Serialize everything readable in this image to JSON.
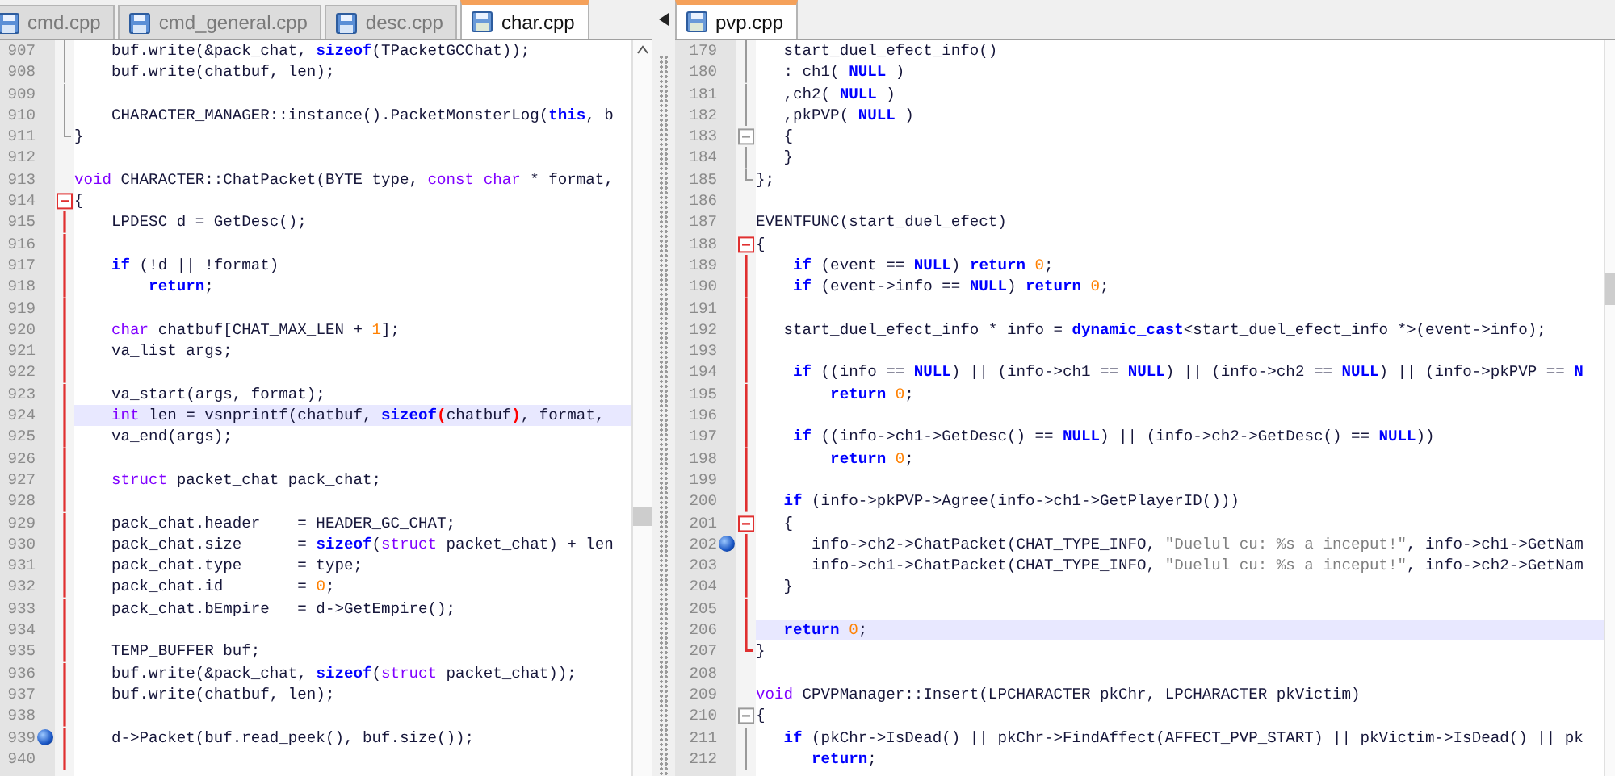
{
  "panes": [
    {
      "tabs": [
        {
          "label": "cmd.cpp",
          "selected": false
        },
        {
          "label": "cmd_general.cpp",
          "selected": false
        },
        {
          "label": "desc.cpp",
          "selected": false
        },
        {
          "label": "char.cpp",
          "selected": true
        }
      ],
      "lines": [
        {
          "number": "907",
          "current": false,
          "bookmarked": false,
          "fold": {
            "kind": "body",
            "active": false
          },
          "tokens": [
            {
              "text": "    buf.write(&pack_chat, ",
              "kind": "plain"
            },
            {
              "text": "sizeof",
              "kind": "keyword"
            },
            {
              "text": "(TPacketGCChat));",
              "kind": "plain"
            }
          ]
        },
        {
          "number": "908",
          "current": false,
          "bookmarked": false,
          "fold": {
            "kind": "body",
            "active": false
          },
          "tokens": [
            {
              "text": "    buf.write(chatbuf, len);",
              "kind": "plain"
            }
          ]
        },
        {
          "number": "909",
          "current": false,
          "bookmarked": false,
          "fold": {
            "kind": "body",
            "active": false
          }
        },
        {
          "number": "910",
          "current": false,
          "bookmarked": false,
          "fold": {
            "kind": "body",
            "active": false
          },
          "tokens": [
            {
              "text": "    CHARACTER_MANAGER::instance().PacketMonsterLog(",
              "kind": "plain"
            },
            {
              "text": "this",
              "kind": "keyword"
            },
            {
              "text": ", b",
              "kind": "plain"
            }
          ]
        },
        {
          "number": "911",
          "current": false,
          "bookmarked": false,
          "fold": {
            "kind": "end",
            "active": false
          },
          "tokens": [
            {
              "text": "}",
              "kind": "plain"
            }
          ]
        },
        {
          "number": "912",
          "current": false,
          "bookmarked": false
        },
        {
          "number": "913",
          "current": false,
          "bookmarked": false,
          "tokens": [
            {
              "text": "void",
              "kind": "type"
            },
            {
              "text": " CHARACTER::ChatPacket(BYTE type, ",
              "kind": "plain"
            },
            {
              "text": "const char",
              "kind": "type"
            },
            {
              "text": " * format,",
              "kind": "plain"
            }
          ]
        },
        {
          "number": "914",
          "current": false,
          "bookmarked": false,
          "fold": {
            "kind": "open",
            "active": true
          },
          "tokens": [
            {
              "text": "{",
              "kind": "plain"
            }
          ]
        },
        {
          "number": "915",
          "current": false,
          "bookmarked": false,
          "fold": {
            "kind": "body",
            "active": true
          },
          "tokens": [
            {
              "text": "    LPDESC d = GetDesc();",
              "kind": "plain"
            }
          ]
        },
        {
          "number": "916",
          "current": false,
          "bookmarked": false,
          "fold": {
            "kind": "body",
            "active": true
          }
        },
        {
          "number": "917",
          "current": false,
          "bookmarked": false,
          "fold": {
            "kind": "body",
            "active": true
          },
          "tokens": [
            {
              "text": "    if",
              "kind": "keyword"
            },
            {
              "text": " (!d || !format)",
              "kind": "plain"
            }
          ]
        },
        {
          "number": "918",
          "current": false,
          "bookmarked": false,
          "fold": {
            "kind": "body",
            "active": true
          },
          "tokens": [
            {
              "text": "        return",
              "kind": "keyword"
            },
            {
              "text": ";",
              "kind": "plain"
            }
          ]
        },
        {
          "number": "919",
          "current": false,
          "bookmarked": false,
          "fold": {
            "kind": "body",
            "active": true
          }
        },
        {
          "number": "920",
          "current": false,
          "bookmarked": false,
          "fold": {
            "kind": "body",
            "active": true
          },
          "tokens": [
            {
              "text": "    char",
              "kind": "type"
            },
            {
              "text": " chatbuf[CHAT_MAX_LEN + ",
              "kind": "plain"
            },
            {
              "text": "1",
              "kind": "number"
            },
            {
              "text": "];",
              "kind": "plain"
            }
          ]
        },
        {
          "number": "921",
          "current": false,
          "bookmarked": false,
          "fold": {
            "kind": "body",
            "active": true
          },
          "tokens": [
            {
              "text": "    va_list args;",
              "kind": "plain"
            }
          ]
        },
        {
          "number": "922",
          "current": false,
          "bookmarked": false,
          "fold": {
            "kind": "body",
            "active": true
          }
        },
        {
          "number": "923",
          "current": false,
          "bookmarked": false,
          "fold": {
            "kind": "body",
            "active": true
          },
          "tokens": [
            {
              "text": "    va_start(args, format);",
              "kind": "plain"
            }
          ]
        },
        {
          "number": "924",
          "current": true,
          "bookmarked": false,
          "fold": {
            "kind": "body",
            "active": true
          },
          "tokens": [
            {
              "text": "    int",
              "kind": "type"
            },
            {
              "text": " len = vsnprintf(chatbuf, ",
              "kind": "plain"
            },
            {
              "text": "sizeof",
              "kind": "keyword"
            },
            {
              "text": "(",
              "kind": "match"
            },
            {
              "text": "chatbuf",
              "kind": "plain"
            },
            {
              "text": ")",
              "kind": "match"
            },
            {
              "text": ", format,",
              "kind": "plain"
            }
          ]
        },
        {
          "number": "925",
          "current": false,
          "bookmarked": false,
          "fold": {
            "kind": "body",
            "active": true
          },
          "tokens": [
            {
              "text": "    va_end(args);",
              "kind": "plain"
            }
          ]
        },
        {
          "number": "926",
          "current": false,
          "bookmarked": false,
          "fold": {
            "kind": "body",
            "active": true
          }
        },
        {
          "number": "927",
          "current": false,
          "bookmarked": false,
          "fold": {
            "kind": "body",
            "active": true
          },
          "tokens": [
            {
              "text": "    struct",
              "kind": "type"
            },
            {
              "text": " packet_chat pack_chat;",
              "kind": "plain"
            }
          ]
        },
        {
          "number": "928",
          "current": false,
          "bookmarked": false,
          "fold": {
            "kind": "body",
            "active": true
          }
        },
        {
          "number": "929",
          "current": false,
          "bookmarked": false,
          "fold": {
            "kind": "body",
            "active": true
          },
          "tokens": [
            {
              "text": "    pack_chat.header    = HEADER_GC_CHAT;",
              "kind": "plain"
            }
          ]
        },
        {
          "number": "930",
          "current": false,
          "bookmarked": false,
          "fold": {
            "kind": "body",
            "active": true
          },
          "tokens": [
            {
              "text": "    pack_chat.size      = ",
              "kind": "plain"
            },
            {
              "text": "sizeof",
              "kind": "keyword"
            },
            {
              "text": "(",
              "kind": "plain"
            },
            {
              "text": "struct",
              "kind": "type"
            },
            {
              "text": " packet_chat) + len",
              "kind": "plain"
            }
          ]
        },
        {
          "number": "931",
          "current": false,
          "bookmarked": false,
          "fold": {
            "kind": "body",
            "active": true
          },
          "tokens": [
            {
              "text": "    pack_chat.type      = type;",
              "kind": "plain"
            }
          ]
        },
        {
          "number": "932",
          "current": false,
          "bookmarked": false,
          "fold": {
            "kind": "body",
            "active": true
          },
          "tokens": [
            {
              "text": "    pack_chat.id        = ",
              "kind": "plain"
            },
            {
              "text": "0",
              "kind": "number"
            },
            {
              "text": ";",
              "kind": "plain"
            }
          ]
        },
        {
          "number": "933",
          "current": false,
          "bookmarked": false,
          "fold": {
            "kind": "body",
            "active": true
          },
          "tokens": [
            {
              "text": "    pack_chat.bEmpire   = d->GetEmpire();",
              "kind": "plain"
            }
          ]
        },
        {
          "number": "934",
          "current": false,
          "bookmarked": false,
          "fold": {
            "kind": "body",
            "active": true
          }
        },
        {
          "number": "935",
          "current": false,
          "bookmarked": false,
          "fold": {
            "kind": "body",
            "active": true
          },
          "tokens": [
            {
              "text": "    TEMP_BUFFER buf;",
              "kind": "plain"
            }
          ]
        },
        {
          "number": "936",
          "current": false,
          "bookmarked": false,
          "fold": {
            "kind": "body",
            "active": true
          },
          "tokens": [
            {
              "text": "    buf.write(&pack_chat, ",
              "kind": "plain"
            },
            {
              "text": "sizeof",
              "kind": "keyword"
            },
            {
              "text": "(",
              "kind": "plain"
            },
            {
              "text": "struct",
              "kind": "type"
            },
            {
              "text": " packet_chat));",
              "kind": "plain"
            }
          ]
        },
        {
          "number": "937",
          "current": false,
          "bookmarked": false,
          "fold": {
            "kind": "body",
            "active": true
          },
          "tokens": [
            {
              "text": "    buf.write(chatbuf, len);",
              "kind": "plain"
            }
          ]
        },
        {
          "number": "938",
          "current": false,
          "bookmarked": false,
          "fold": {
            "kind": "body",
            "active": true
          }
        },
        {
          "number": "939",
          "current": false,
          "bookmarked": true,
          "fold": {
            "kind": "body",
            "active": true
          },
          "tokens": [
            {
              "text": "    d->Packet(buf.read_peek(), buf.size());",
              "kind": "plain"
            }
          ]
        },
        {
          "number": "940",
          "current": false,
          "bookmarked": false,
          "fold": {
            "kind": "body",
            "active": true
          }
        }
      ]
    },
    {
      "tabs": [
        {
          "label": "pvp.cpp",
          "selected": true
        }
      ],
      "lines": [
        {
          "number": "179",
          "current": false,
          "bookmarked": false,
          "fold": {
            "kind": "body",
            "active": false
          },
          "tokens": [
            {
              "text": "   start_duel_efect_info()",
              "kind": "plain"
            }
          ]
        },
        {
          "number": "180",
          "current": false,
          "bookmarked": false,
          "fold": {
            "kind": "body",
            "active": false
          },
          "tokens": [
            {
              "text": "   : ch1( ",
              "kind": "plain"
            },
            {
              "text": "NULL",
              "kind": "keyword"
            },
            {
              "text": " )",
              "kind": "plain"
            }
          ]
        },
        {
          "number": "181",
          "current": false,
          "bookmarked": false,
          "fold": {
            "kind": "body",
            "active": false
          },
          "tokens": [
            {
              "text": "   ,ch2( ",
              "kind": "plain"
            },
            {
              "text": "NULL",
              "kind": "keyword"
            },
            {
              "text": " )",
              "kind": "plain"
            }
          ]
        },
        {
          "number": "182",
          "current": false,
          "bookmarked": false,
          "fold": {
            "kind": "body",
            "active": false
          },
          "tokens": [
            {
              "text": "   ,pkPVP( ",
              "kind": "plain"
            },
            {
              "text": "NULL",
              "kind": "keyword"
            },
            {
              "text": " )",
              "kind": "plain"
            }
          ]
        },
        {
          "number": "183",
          "current": false,
          "bookmarked": false,
          "fold": {
            "kind": "open",
            "active": false
          },
          "tokens": [
            {
              "text": "   {",
              "kind": "plain"
            }
          ]
        },
        {
          "number": "184",
          "current": false,
          "bookmarked": false,
          "fold": {
            "kind": "body",
            "active": false
          },
          "tokens": [
            {
              "text": "   }",
              "kind": "plain"
            }
          ]
        },
        {
          "number": "185",
          "current": false,
          "bookmarked": false,
          "fold": {
            "kind": "end",
            "active": false
          },
          "tokens": [
            {
              "text": "};",
              "kind": "plain"
            }
          ]
        },
        {
          "number": "186",
          "current": false,
          "bookmarked": false
        },
        {
          "number": "187",
          "current": false,
          "bookmarked": false,
          "tokens": [
            {
              "text": "EVENTFUNC(start_duel_efect)",
              "kind": "plain"
            }
          ]
        },
        {
          "number": "188",
          "current": false,
          "bookmarked": false,
          "fold": {
            "kind": "open",
            "active": true
          },
          "tokens": [
            {
              "text": "{",
              "kind": "plain"
            }
          ]
        },
        {
          "number": "189",
          "current": false,
          "bookmarked": false,
          "fold": {
            "kind": "body",
            "active": true
          },
          "tokens": [
            {
              "text": "    if",
              "kind": "keyword"
            },
            {
              "text": " (event == ",
              "kind": "plain"
            },
            {
              "text": "NULL",
              "kind": "keyword"
            },
            {
              "text": ") ",
              "kind": "plain"
            },
            {
              "text": "return ",
              "kind": "keyword"
            },
            {
              "text": "0",
              "kind": "number"
            },
            {
              "text": ";",
              "kind": "plain"
            }
          ]
        },
        {
          "number": "190",
          "current": false,
          "bookmarked": false,
          "fold": {
            "kind": "body",
            "active": true
          },
          "tokens": [
            {
              "text": "    if",
              "kind": "keyword"
            },
            {
              "text": " (event->info == ",
              "kind": "plain"
            },
            {
              "text": "NULL",
              "kind": "keyword"
            },
            {
              "text": ") ",
              "kind": "plain"
            },
            {
              "text": "return ",
              "kind": "keyword"
            },
            {
              "text": "0",
              "kind": "number"
            },
            {
              "text": ";",
              "kind": "plain"
            }
          ]
        },
        {
          "number": "191",
          "current": false,
          "bookmarked": false,
          "fold": {
            "kind": "body",
            "active": true
          }
        },
        {
          "number": "192",
          "current": false,
          "bookmarked": false,
          "fold": {
            "kind": "body",
            "active": true
          },
          "tokens": [
            {
              "text": "   start_duel_efect_info * info = ",
              "kind": "plain"
            },
            {
              "text": "dynamic_cast",
              "kind": "keyword"
            },
            {
              "text": "<start_duel_efect_info *>(event->info);",
              "kind": "plain"
            }
          ]
        },
        {
          "number": "193",
          "current": false,
          "bookmarked": false,
          "fold": {
            "kind": "body",
            "active": true
          }
        },
        {
          "number": "194",
          "current": false,
          "bookmarked": false,
          "fold": {
            "kind": "body",
            "active": true
          },
          "tokens": [
            {
              "text": "    if",
              "kind": "keyword"
            },
            {
              "text": " ((info == ",
              "kind": "plain"
            },
            {
              "text": "NULL",
              "kind": "keyword"
            },
            {
              "text": ") || (info->ch1 == ",
              "kind": "plain"
            },
            {
              "text": "NULL",
              "kind": "keyword"
            },
            {
              "text": ") || (info->ch2 == ",
              "kind": "plain"
            },
            {
              "text": "NULL",
              "kind": "keyword"
            },
            {
              "text": ") || (info->pkPVP == ",
              "kind": "plain"
            },
            {
              "text": "N",
              "kind": "keyword"
            }
          ]
        },
        {
          "number": "195",
          "current": false,
          "bookmarked": false,
          "fold": {
            "kind": "body",
            "active": true
          },
          "tokens": [
            {
              "text": "        return ",
              "kind": "keyword"
            },
            {
              "text": "0",
              "kind": "number"
            },
            {
              "text": ";",
              "kind": "plain"
            }
          ]
        },
        {
          "number": "196",
          "current": false,
          "bookmarked": false,
          "fold": {
            "kind": "body",
            "active": true
          }
        },
        {
          "number": "197",
          "current": false,
          "bookmarked": false,
          "fold": {
            "kind": "body",
            "active": true
          },
          "tokens": [
            {
              "text": "    if",
              "kind": "keyword"
            },
            {
              "text": " ((info->ch1->GetDesc() == ",
              "kind": "plain"
            },
            {
              "text": "NULL",
              "kind": "keyword"
            },
            {
              "text": ") || (info->ch2->GetDesc() == ",
              "kind": "plain"
            },
            {
              "text": "NULL",
              "kind": "keyword"
            },
            {
              "text": "))",
              "kind": "plain"
            }
          ]
        },
        {
          "number": "198",
          "current": false,
          "bookmarked": false,
          "fold": {
            "kind": "body",
            "active": true
          },
          "tokens": [
            {
              "text": "        return ",
              "kind": "keyword"
            },
            {
              "text": "0",
              "kind": "number"
            },
            {
              "text": ";",
              "kind": "plain"
            }
          ]
        },
        {
          "number": "199",
          "current": false,
          "bookmarked": false,
          "fold": {
            "kind": "body",
            "active": true
          }
        },
        {
          "number": "200",
          "current": false,
          "bookmarked": false,
          "fold": {
            "kind": "body",
            "active": true
          },
          "tokens": [
            {
              "text": "   if",
              "kind": "keyword"
            },
            {
              "text": " (info->pkPVP->Agree(info->ch1->GetPlayerID()))",
              "kind": "plain"
            }
          ]
        },
        {
          "number": "201",
          "current": false,
          "bookmarked": false,
          "fold": {
            "kind": "open",
            "active": true
          },
          "tokens": [
            {
              "text": "   {",
              "kind": "plain"
            }
          ]
        },
        {
          "number": "202",
          "current": false,
          "bookmarked": true,
          "fold": {
            "kind": "body",
            "active": true
          },
          "tokens": [
            {
              "text": "      info->ch2->ChatPacket(CHAT_TYPE_INFO, ",
              "kind": "plain"
            },
            {
              "text": "\"Duelul cu: %s a inceput!\"",
              "kind": "string"
            },
            {
              "text": ", info->ch1->GetNam",
              "kind": "plain"
            }
          ]
        },
        {
          "number": "203",
          "current": false,
          "bookmarked": false,
          "fold": {
            "kind": "body",
            "active": true
          },
          "tokens": [
            {
              "text": "      info->ch1->ChatPacket(CHAT_TYPE_INFO, ",
              "kind": "plain"
            },
            {
              "text": "\"Duelul cu: %s a inceput!\"",
              "kind": "string"
            },
            {
              "text": ", info->ch2->GetNam",
              "kind": "plain"
            }
          ]
        },
        {
          "number": "204",
          "current": false,
          "bookmarked": false,
          "fold": {
            "kind": "body",
            "active": true
          },
          "tokens": [
            {
              "text": "   }",
              "kind": "plain"
            }
          ]
        },
        {
          "number": "205",
          "current": false,
          "bookmarked": false,
          "fold": {
            "kind": "body",
            "active": true
          }
        },
        {
          "number": "206",
          "current": true,
          "bookmarked": false,
          "fold": {
            "kind": "body",
            "active": true
          },
          "tokens": [
            {
              "text": "   return ",
              "kind": "keyword"
            },
            {
              "text": "0",
              "kind": "number"
            },
            {
              "text": ";",
              "kind": "plain"
            }
          ]
        },
        {
          "number": "207",
          "current": false,
          "bookmarked": false,
          "fold": {
            "kind": "end",
            "active": true
          },
          "tokens": [
            {
              "text": "}",
              "kind": "plain"
            }
          ]
        },
        {
          "number": "208",
          "current": false,
          "bookmarked": false
        },
        {
          "number": "209",
          "current": false,
          "bookmarked": false,
          "tokens": [
            {
              "text": "void",
              "kind": "type"
            },
            {
              "text": " CPVPManager::Insert(LPCHARACTER pkChr, LPCHARACTER pkVictim)",
              "kind": "plain"
            }
          ]
        },
        {
          "number": "210",
          "current": false,
          "bookmarked": false,
          "fold": {
            "kind": "open",
            "active": false
          },
          "tokens": [
            {
              "text": "{",
              "kind": "plain"
            }
          ]
        },
        {
          "number": "211",
          "current": false,
          "bookmarked": false,
          "fold": {
            "kind": "body",
            "active": false
          },
          "tokens": [
            {
              "text": "   if",
              "kind": "keyword"
            },
            {
              "text": " (pkChr->IsDead() || pkChr->FindAffect(AFFECT_PVP_START) || pkVictim->IsDead() || pk",
              "kind": "plain"
            }
          ]
        },
        {
          "number": "212",
          "current": false,
          "bookmarked": false,
          "fold": {
            "kind": "body",
            "active": false
          },
          "tokens": [
            {
              "text": "      return",
              "kind": "keyword"
            },
            {
              "text": ";",
              "kind": "plain"
            }
          ]
        }
      ]
    }
  ]
}
